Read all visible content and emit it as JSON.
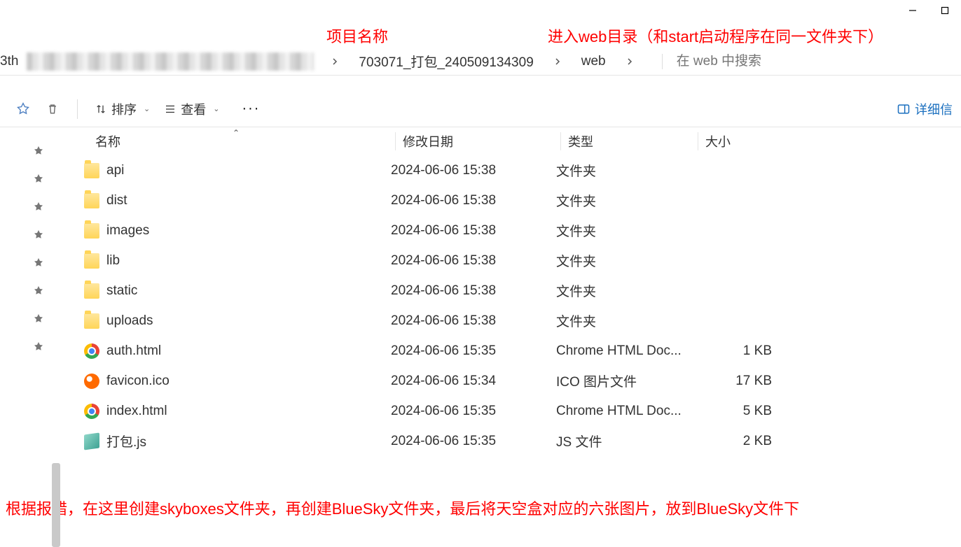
{
  "window": {
    "title_prefix": "3th"
  },
  "annotations": {
    "project_name": "项目名称",
    "enter_web": "进入web目录（和start启动程序在同一文件夹下）",
    "bottom_note": "根据报错，在这里创建skyboxes文件夹，再创建BlueSky文件夹，最后将天空盒对应的六张图片，放到BlueSky文件下"
  },
  "breadcrumb": {
    "segments": [
      "703071_打包_240509134309",
      "web"
    ]
  },
  "search": {
    "placeholder": "在 web 中搜索"
  },
  "toolbar": {
    "sort_label": "排序",
    "view_label": "查看",
    "details_label": "详细信"
  },
  "columns": {
    "name": "名称",
    "date": "修改日期",
    "type": "类型",
    "size": "大小"
  },
  "files": [
    {
      "icon": "folder",
      "name": "api",
      "date": "2024-06-06 15:38",
      "type": "文件夹",
      "size": ""
    },
    {
      "icon": "folder",
      "name": "dist",
      "date": "2024-06-06 15:38",
      "type": "文件夹",
      "size": ""
    },
    {
      "icon": "folder",
      "name": "images",
      "date": "2024-06-06 15:38",
      "type": "文件夹",
      "size": ""
    },
    {
      "icon": "folder",
      "name": "lib",
      "date": "2024-06-06 15:38",
      "type": "文件夹",
      "size": ""
    },
    {
      "icon": "folder",
      "name": "static",
      "date": "2024-06-06 15:38",
      "type": "文件夹",
      "size": ""
    },
    {
      "icon": "folder",
      "name": "uploads",
      "date": "2024-06-06 15:38",
      "type": "文件夹",
      "size": ""
    },
    {
      "icon": "chrome",
      "name": "auth.html",
      "date": "2024-06-06 15:35",
      "type": "Chrome HTML Doc...",
      "size": "1 KB"
    },
    {
      "icon": "ico",
      "name": "favicon.ico",
      "date": "2024-06-06 15:34",
      "type": "ICO 图片文件",
      "size": "17 KB"
    },
    {
      "icon": "chrome",
      "name": "index.html",
      "date": "2024-06-06 15:35",
      "type": "Chrome HTML Doc...",
      "size": "5 KB"
    },
    {
      "icon": "js",
      "name": "打包.js",
      "date": "2024-06-06 15:35",
      "type": "JS 文件",
      "size": "2 KB"
    }
  ],
  "pins_count": 8
}
